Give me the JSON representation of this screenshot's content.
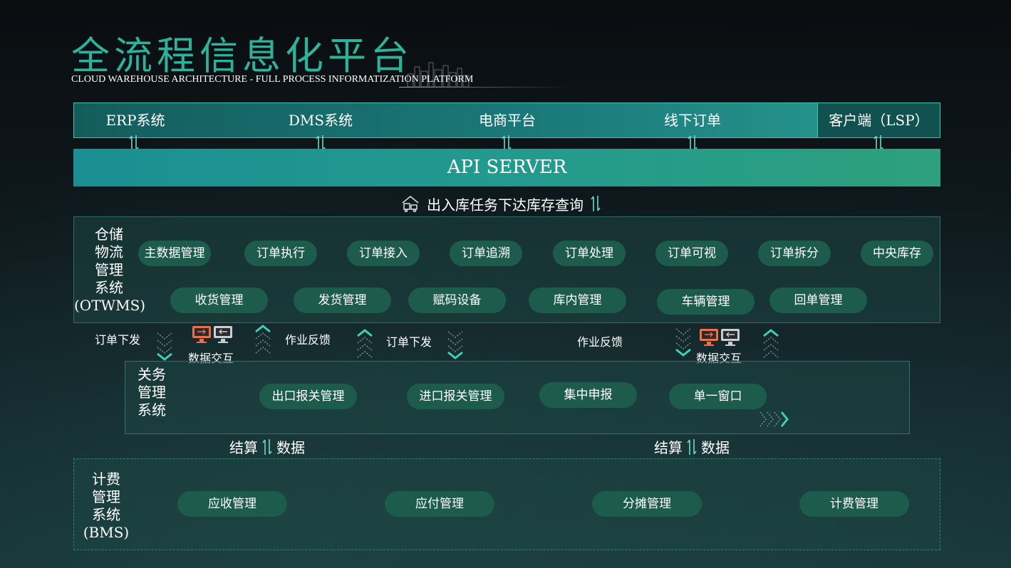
{
  "header": {
    "title": "全流程信息化平台",
    "subtitle": "CLOUD WAREHOUSE ARCHITECTURE - FULL PROCESS INFORMATIZATION PLATFORM"
  },
  "systems": {
    "items": [
      "ERP系统",
      "DMS系统",
      "电商平台",
      "线下订单"
    ],
    "client": "客户端（LSP）"
  },
  "api": {
    "label": "API SERVER"
  },
  "task": {
    "label": "出入库任务下达库存查询"
  },
  "otwms": {
    "label": "仓储\n物流\n管理\n系统\n(OTWMS)",
    "row1": [
      "主数据管理",
      "订单执行",
      "订单接入",
      "订单追溯",
      "订单处理",
      "订单可视",
      "订单拆分",
      "中央库存"
    ],
    "row2": [
      "收货管理",
      "发货管理",
      "赋码设备",
      "库内管理",
      "车辆管理",
      "回单管理"
    ]
  },
  "flows": {
    "order_down_1": "订单下发",
    "data_exchange_1": "数据交互",
    "job_feedback_1": "作业反馈",
    "order_down_2": "订单下发",
    "job_feedback_2": "作业反馈",
    "data_exchange_2": "数据交互"
  },
  "customs": {
    "label": "关务\n管理\n系统",
    "items": [
      "出口报关管理",
      "进口报关管理",
      "集中申报",
      "单一窗口"
    ]
  },
  "settlement": {
    "left_a": "结算",
    "left_b": "数据",
    "right_a": "结算",
    "right_b": "数据"
  },
  "bms": {
    "label": "计费\n管理\n系统\n(BMS)",
    "items": [
      "应收管理",
      "应付管理",
      "分摊管理",
      "计费管理"
    ]
  },
  "colors": {
    "title": "#2fb29b",
    "pill": "#1d5c4c",
    "accent": "#3fc3b0",
    "icon_orange": "#e8704a"
  },
  "icons": [
    "skyline-icon",
    "arrow-up-down-icon",
    "truck-warehouse-icon",
    "computer-icon",
    "chevron-down-icon",
    "chevron-up-icon",
    "chevron-right-icon"
  ]
}
